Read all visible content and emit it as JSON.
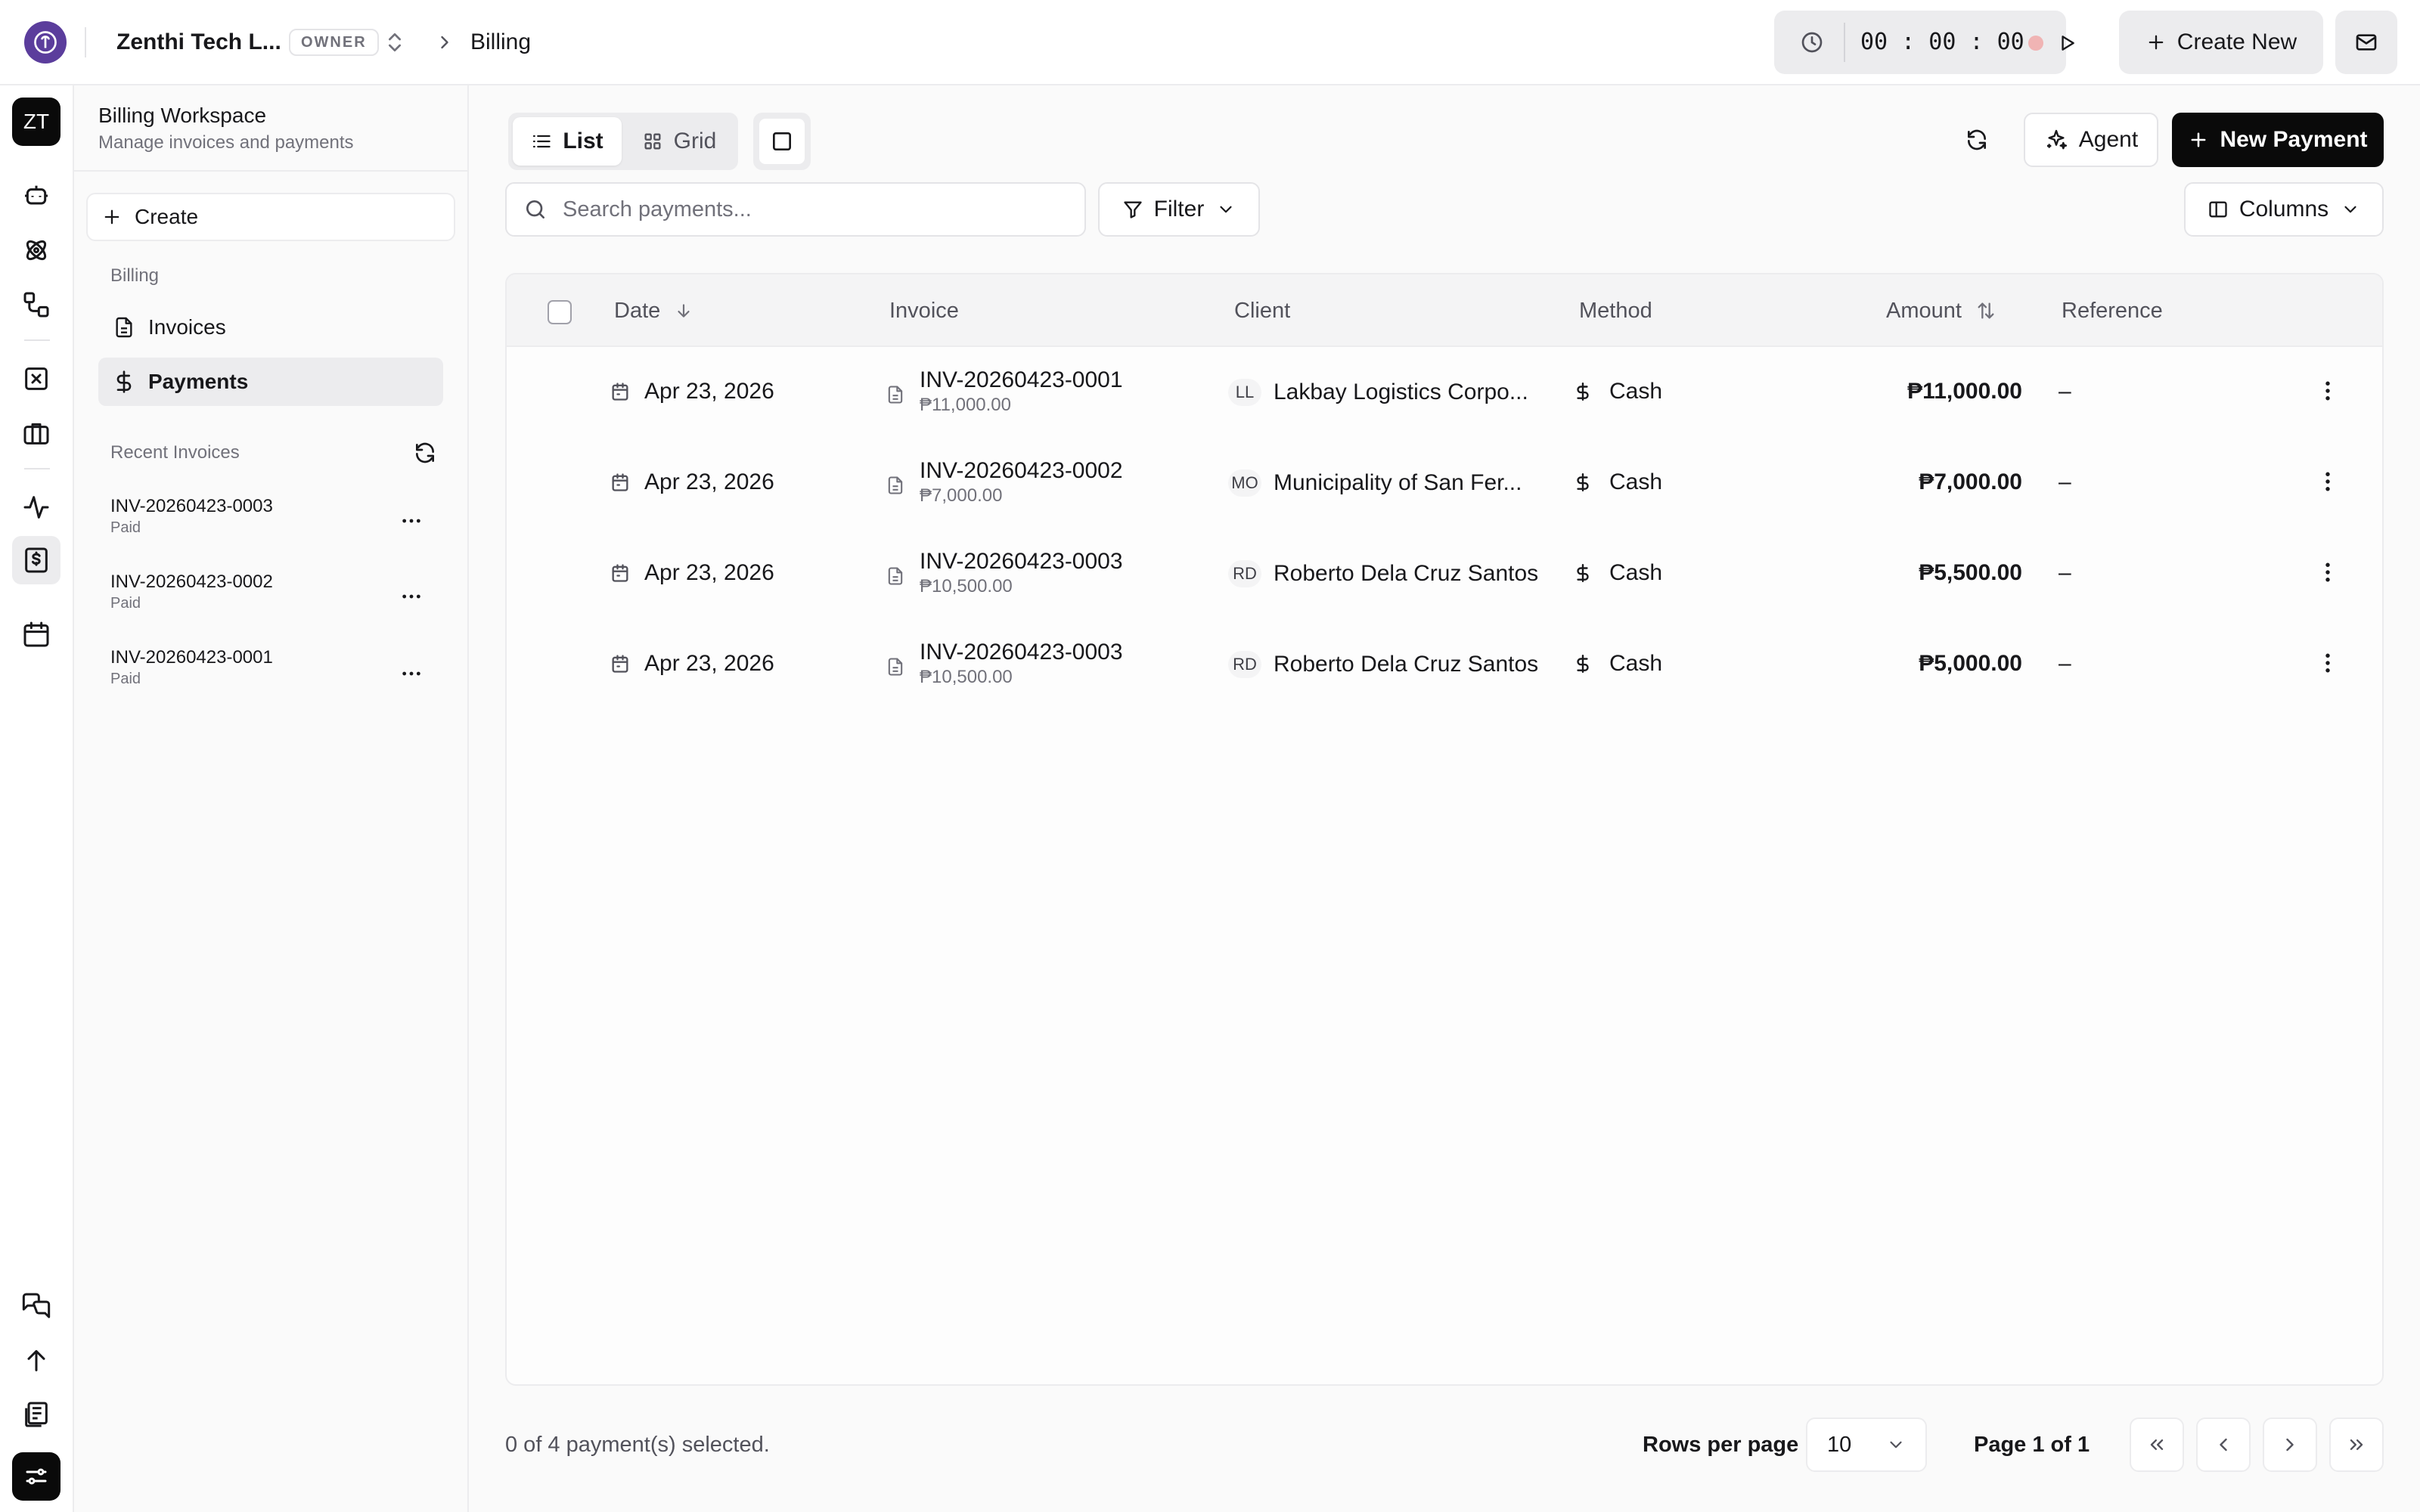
{
  "topbar": {
    "org_name": "Zenthi Tech L...",
    "role_badge": "OWNER",
    "breadcrumb": "Billing",
    "timer": "00 : 00 : 00",
    "create_new_label": "Create New"
  },
  "rail": {
    "workspace_initials": "ZT",
    "icons": [
      "bot-icon",
      "atom-icon",
      "workflow-icon",
      "x-square-icon",
      "briefcase-icon",
      "activity-icon",
      "billing-icon",
      "calendar-icon",
      "messages-icon",
      "upload-icon",
      "reports-icon",
      "settings-icon"
    ]
  },
  "sidebar": {
    "workspace_title": "Billing Workspace",
    "workspace_subtitle": "Manage invoices and payments",
    "create_label": "Create",
    "section_label": "Billing",
    "nav": [
      {
        "label": "Invoices",
        "icon": "file-text-icon",
        "active": false
      },
      {
        "label": "Payments",
        "icon": "dollar-icon",
        "active": true
      }
    ],
    "recent_label": "Recent Invoices",
    "recent_invoices": [
      {
        "id": "INV-20260423-0003",
        "status": "Paid"
      },
      {
        "id": "INV-20260423-0002",
        "status": "Paid"
      },
      {
        "id": "INV-20260423-0001",
        "status": "Paid"
      }
    ]
  },
  "toolbar": {
    "view_list": "List",
    "view_grid": "Grid",
    "agent_label": "Agent",
    "new_payment_label": "New Payment",
    "search_placeholder": "Search payments...",
    "filter_label": "Filter",
    "columns_label": "Columns"
  },
  "table": {
    "columns": {
      "date": "Date",
      "invoice": "Invoice",
      "client": "Client",
      "method": "Method",
      "amount": "Amount",
      "reference": "Reference"
    },
    "rows": [
      {
        "date": "Apr 23, 2026",
        "invoice": "INV-20260423-0001",
        "invoice_amount": "₱11,000.00",
        "client_initials": "LL",
        "client": "Lakbay Logistics Corpo...",
        "method": "Cash",
        "amount": "₱11,000.00",
        "reference": "–"
      },
      {
        "date": "Apr 23, 2026",
        "invoice": "INV-20260423-0002",
        "invoice_amount": "₱7,000.00",
        "client_initials": "MO",
        "client": "Municipality of San Fer...",
        "method": "Cash",
        "amount": "₱7,000.00",
        "reference": "–"
      },
      {
        "date": "Apr 23, 2026",
        "invoice": "INV-20260423-0003",
        "invoice_amount": "₱10,500.00",
        "client_initials": "RD",
        "client": "Roberto Dela Cruz Santos",
        "method": "Cash",
        "amount": "₱5,500.00",
        "reference": "–"
      },
      {
        "date": "Apr 23, 2026",
        "invoice": "INV-20260423-0003",
        "invoice_amount": "₱10,500.00",
        "client_initials": "RD",
        "client": "Roberto Dela Cruz Santos",
        "method": "Cash",
        "amount": "₱5,000.00",
        "reference": "–"
      }
    ]
  },
  "footer": {
    "selection": "0 of 4 payment(s) selected.",
    "rows_per_page_label": "Rows per page",
    "rows_per_page": "10",
    "page_label": "Page 1 of 1"
  },
  "colors": {
    "brand": "#5b3d9c",
    "primary_button": "#0a0a0a",
    "recording_dot": "#f0b4b4"
  }
}
